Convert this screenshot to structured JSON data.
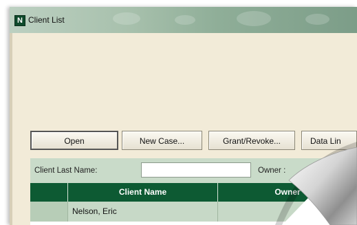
{
  "window": {
    "title": "Client List",
    "app_icon_letter": "N"
  },
  "toolbar": {
    "open_label": "Open",
    "new_case_label": "New Case...",
    "grant_revoke_label": "Grant/Revoke...",
    "data_link_label": "Data Lin"
  },
  "filter": {
    "client_last_name_label": "Client Last Name:",
    "client_last_name_value": "",
    "owner_label": "Owner :"
  },
  "table": {
    "columns": [
      "",
      "Client Name",
      "Owner"
    ],
    "rows": [
      {
        "client_name": "Nelson, Eric",
        "owner": ""
      }
    ]
  },
  "colors": {
    "window_background": "#f2ebd8",
    "header_green": "#0d5a33",
    "row_green": "#c7d9c7",
    "filter_bar_green": "#c9dbc9"
  }
}
